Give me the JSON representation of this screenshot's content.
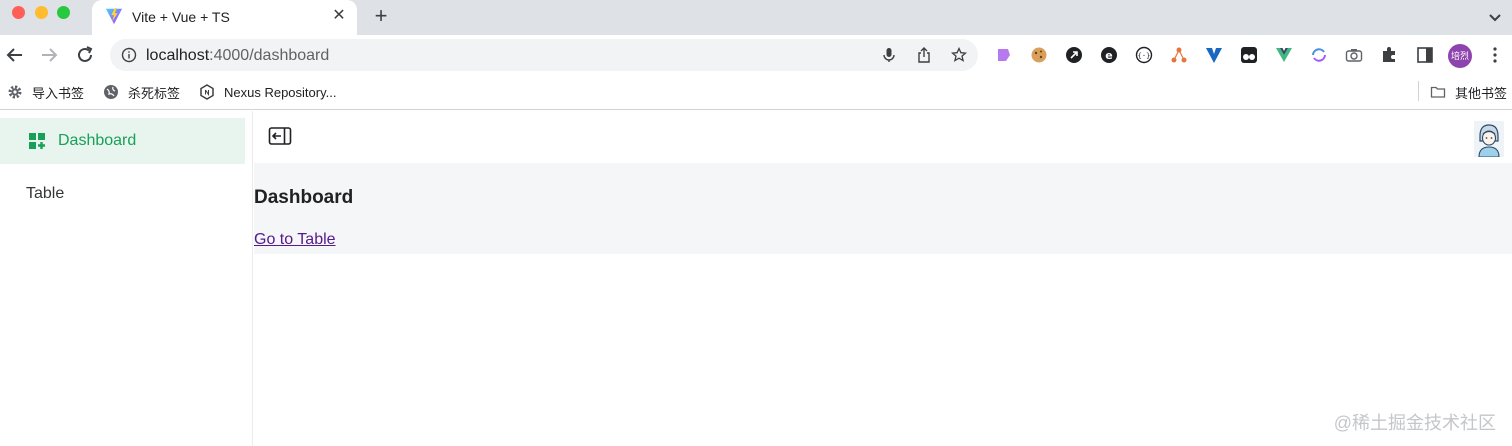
{
  "browser": {
    "tab": {
      "title": "Vite + Vue + TS",
      "favicon": "vite-logo"
    },
    "url": {
      "host": "localhost",
      "path": ":4000/dashboard"
    },
    "profile_label": "培烈",
    "bookmarks": [
      {
        "label": "导入书签",
        "icon": "gear-icon"
      },
      {
        "label": "杀死标签",
        "icon": "globe-icon"
      },
      {
        "label": "Nexus Repository...",
        "icon": "hexagon-icon"
      }
    ],
    "other_bookmarks": "其他书签"
  },
  "app": {
    "sidebar": {
      "items": [
        {
          "label": "Dashboard",
          "icon": "dashboard-icon",
          "active": true
        },
        {
          "label": "Table",
          "active": false
        }
      ]
    },
    "page": {
      "title": "Dashboard",
      "link": "Go to Table"
    }
  },
  "watermark": "@稀土掘金技术社区",
  "colors": {
    "accent": "#18a058",
    "active_bg": "#e8f5ee",
    "content_bg": "#f5f6f8",
    "link": "#551a8b"
  }
}
